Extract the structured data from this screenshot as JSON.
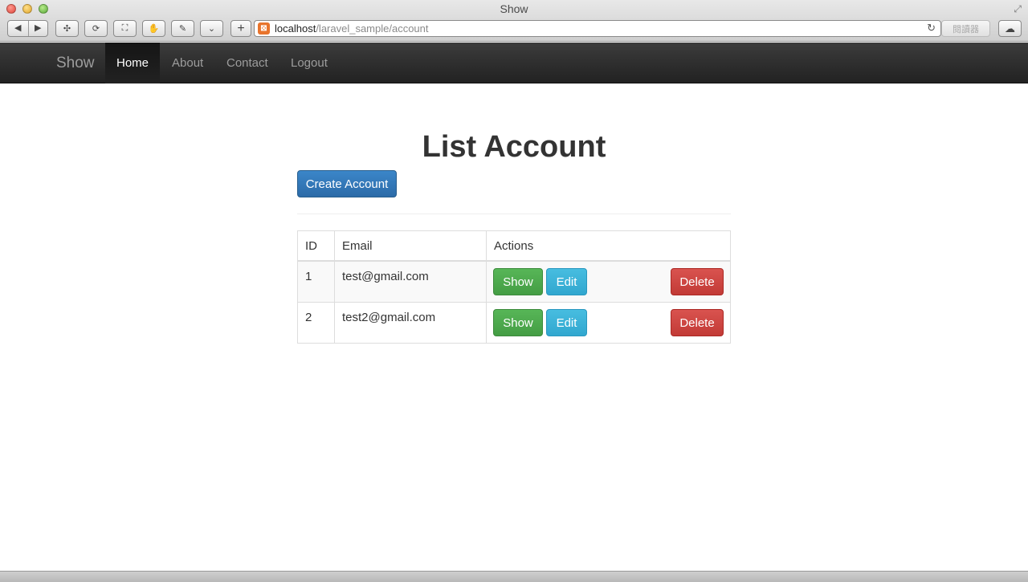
{
  "window": {
    "title": "Show",
    "url_host": "localhost",
    "url_path": "/laravel_sample/account",
    "reader_label": "閱讀器",
    "favicon_glyph": "⊠"
  },
  "navbar": {
    "brand": "Show",
    "items": [
      {
        "label": "Home",
        "active": true
      },
      {
        "label": "About",
        "active": false
      },
      {
        "label": "Contact",
        "active": false
      },
      {
        "label": "Logout",
        "active": false
      }
    ]
  },
  "page": {
    "title": "List Account",
    "create_button": "Create Account"
  },
  "table": {
    "headers": [
      "ID",
      "Email",
      "Actions"
    ],
    "rows": [
      {
        "id": "1",
        "email": "test@gmail.com"
      },
      {
        "id": "2",
        "email": "test2@gmail.com"
      }
    ],
    "actions": {
      "show": "Show",
      "edit": "Edit",
      "delete": "Delete"
    }
  },
  "colors": {
    "primary": "#337ab7",
    "success": "#5cb85c",
    "info": "#5bc0de",
    "danger": "#d9534f",
    "navbar": "#222222"
  }
}
